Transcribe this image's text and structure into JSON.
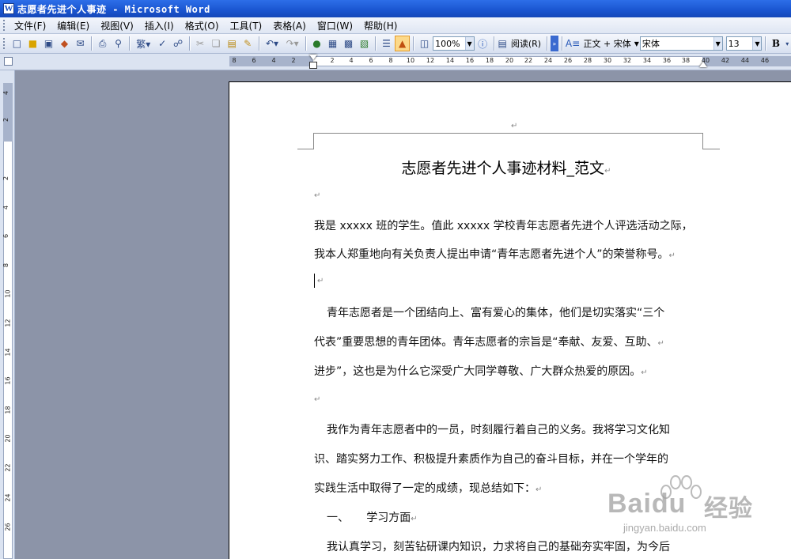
{
  "window": {
    "title": "志愿者先进个人事迹 - Microsoft Word",
    "icon_letter": "W"
  },
  "menu": [
    "文件(F)",
    "编辑(E)",
    "视图(V)",
    "插入(I)",
    "格式(O)",
    "工具(T)",
    "表格(A)",
    "窗口(W)",
    "帮助(H)"
  ],
  "toolbar": {
    "zoom": "100%",
    "read_label": "阅读(R)",
    "style": "正文 + 宋体",
    "font": "宋体",
    "font_size": "13",
    "bold_label": "B"
  },
  "ruler": {
    "h_ticks": [
      "8",
      "6",
      "4",
      "2",
      "2",
      "4",
      "6",
      "8",
      "10",
      "12",
      "14",
      "16",
      "18",
      "20",
      "22",
      "24",
      "26",
      "28",
      "30",
      "32",
      "34",
      "36",
      "38",
      "40",
      "42",
      "44",
      "46"
    ],
    "v_ticks": [
      "4",
      "2",
      "2",
      "4",
      "6",
      "8",
      "10",
      "12",
      "14",
      "16",
      "18",
      "20",
      "22",
      "24",
      "26"
    ]
  },
  "document": {
    "title": "志愿者先进个人事迹材料_范文",
    "lines": [
      "我是 xxxxx 班的学生。值此 xxxxx 学校青年志愿者先进个人评选活动之际，",
      "我本人郑重地向有关负责人提出申请“青年志愿者先进个人”的荣誉称号。",
      "青年志愿者是一个团结向上、富有爱心的集体，他们是切实落实“三个",
      "代表”重要思想的青年团体。青年志愿者的宗旨是“奉献、友爱、互助、",
      "进步”，这也是为什么它深受广大同学尊敬、广大群众热爱的原因。",
      "我作为青年志愿者中的一员，时刻履行着自己的义务。我将学习文化知",
      "识、踏实努力工作、积极提升素质作为自己的奋斗目标，并在一个学年的",
      "实践生活中取得了一定的成绩，现总结如下：",
      "一、     学习方面",
      "我认真学习，刻苦钻研课内知识，力求将自己的基础夯实牢固，为今后"
    ]
  },
  "watermark": {
    "brand": "Baidu",
    "suffix": "经验",
    "url": "jingyan.baidu.com"
  }
}
